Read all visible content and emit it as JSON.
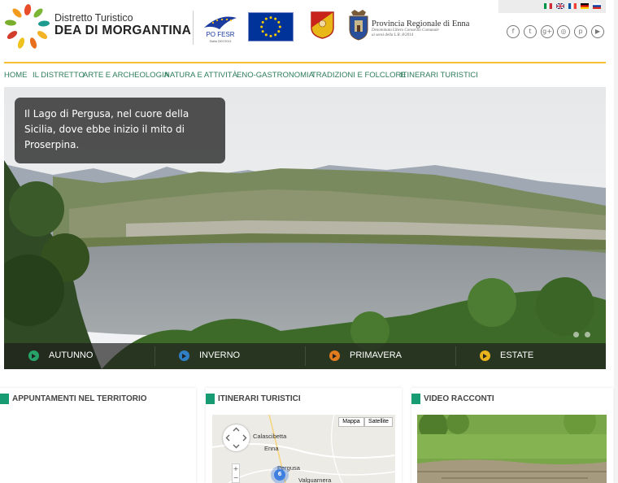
{
  "brand": {
    "line1": "Distretto Turistico",
    "line2": "DEA DI MORGANTINA",
    "logo_icon": "wheat-wreath-logo-icon"
  },
  "partners": {
    "po_fesr": "PO FESR",
    "po_fesr_sub": "Sicilia 2007/2013",
    "provincia_title": "Provincia Regionale di Enna",
    "provincia_sub1": "Denominata Libero Consorzio Comunale",
    "provincia_sub2": "ai sensi della L.R. 8/2014"
  },
  "languages": [
    "italian-flag-icon",
    "english-flag-icon",
    "french-flag-icon",
    "german-flag-icon",
    "russian-flag-icon"
  ],
  "socials": [
    {
      "icon": "facebook-icon",
      "glyph": "f"
    },
    {
      "icon": "twitter-icon",
      "glyph": "t"
    },
    {
      "icon": "google-plus-icon",
      "glyph": "g+"
    },
    {
      "icon": "instagram-icon",
      "glyph": "◎"
    },
    {
      "icon": "pinterest-icon",
      "glyph": "p"
    },
    {
      "icon": "youtube-icon",
      "glyph": "▶"
    }
  ],
  "nav": {
    "items": [
      "HOME",
      "IL DISTRETTO",
      "ARTE E ARCHEOLOGIA",
      "NATURA E ATTIVITÀ",
      "ENO-GASTRONOMIA",
      "TRADIZIONI E FOLCLORE",
      "ITINERARI TURISTICI"
    ]
  },
  "hero": {
    "caption": "Il Lago di Pergusa, nel cuore della Sicilia, dove ebbe inizio il mito di Proserpina.",
    "seasons": [
      {
        "label": "AUTUNNO",
        "color": "#27a36a"
      },
      {
        "label": "INVERNO",
        "color": "#2f7fc4"
      },
      {
        "label": "PRIMAVERA",
        "color": "#e07b1e"
      },
      {
        "label": "ESTATE",
        "color": "#e8b21c"
      }
    ]
  },
  "panels": {
    "appuntamenti": "APPUNTAMENTI NEL TERRITORIO",
    "itinerari": "ITINERARI TURISTICI",
    "video": "VIDEO RACCONTI"
  },
  "map": {
    "type_map": "Mappa",
    "type_satellite": "Satellite",
    "labels": [
      "Calascibetta",
      "Enna",
      "Pergusa",
      "Valguarnera"
    ],
    "cluster_count": "6",
    "zoom_in": "+",
    "zoom_out": "−"
  },
  "colors": {
    "accent_green": "#179b73",
    "nav_green": "#2e7d5b",
    "gold": "#f5c034"
  }
}
